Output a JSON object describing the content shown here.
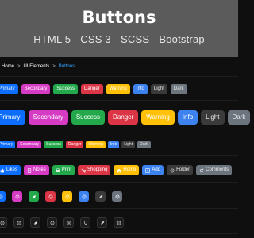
{
  "header": {
    "title": "Buttons",
    "subtitle": "HTML 5 - CSS 3 - SCSS - Bootstrap"
  },
  "breadcrumb": {
    "items": [
      "Home",
      "UI Elements",
      "Buttons"
    ],
    "separator": ">"
  },
  "rows": {
    "default": [
      "Primary",
      "Secondary",
      "Success",
      "Danger",
      "Warning",
      "Info",
      "Light",
      "Dark"
    ],
    "large": [
      "Primary",
      "Secondary",
      "Success",
      "Danger",
      "Warning",
      "Info",
      "Light",
      "Dark"
    ],
    "small": [
      "Primary",
      "Secondary",
      "Success",
      "Danger",
      "Warning",
      "Info",
      "Light",
      "Dark"
    ],
    "with_icons": [
      "Likes",
      "Notes",
      "Print",
      "Shopping",
      "Home",
      "Add",
      "Folder",
      "Comments"
    ]
  },
  "icon_rows": {
    "filled": [
      "circle-icon",
      "circle-icon",
      "leaf-icon",
      "heart-icon",
      "star-icon",
      "user-icon",
      "pen-icon",
      "globe-icon"
    ],
    "outline": [
      "circle-icon",
      "circle-icon",
      "leaf-icon",
      "heart-icon",
      "camera-icon",
      "pin-icon",
      "pen-icon",
      "globe-icon"
    ]
  },
  "colors": {
    "primary": "#0d6efd",
    "secondary": "#d63bc4",
    "success": "#23a94b",
    "danger": "#dc3545",
    "warning": "#ffc107",
    "info": "#3d83f0",
    "light": "#3a3a3a",
    "dark": "#6c757d",
    "accent": "#36a3ff"
  }
}
